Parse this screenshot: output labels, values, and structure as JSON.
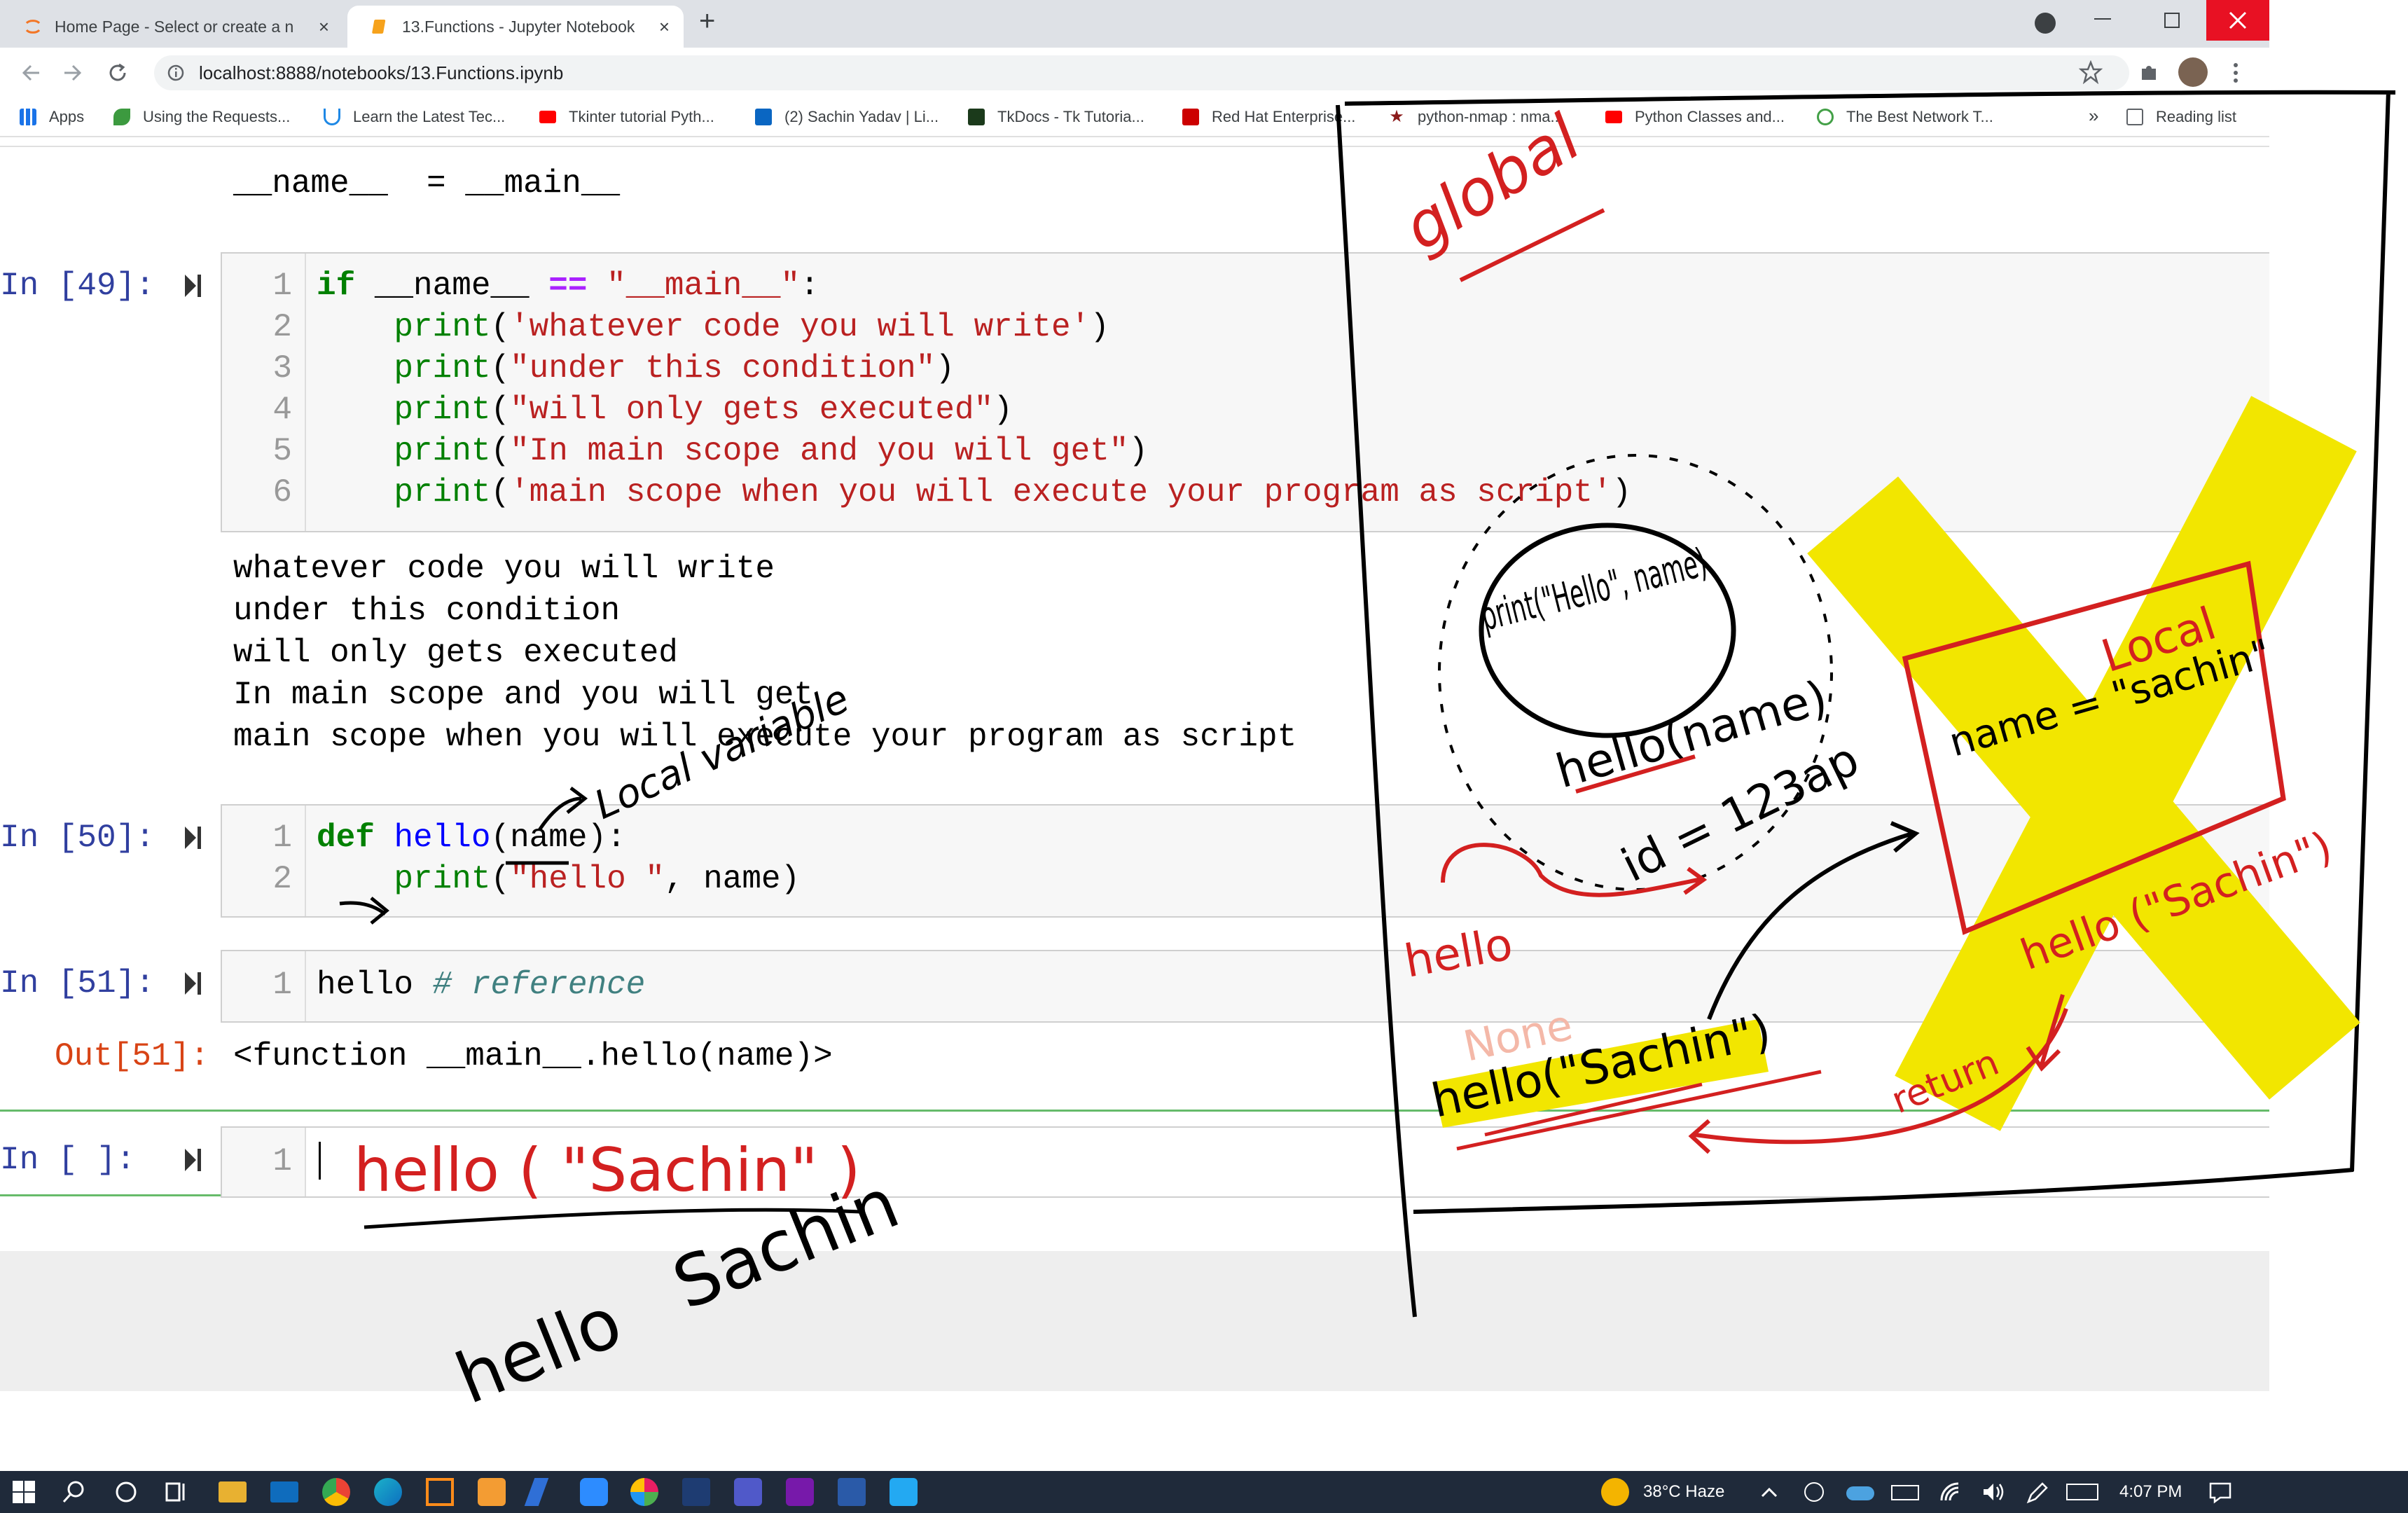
{
  "browser": {
    "tabs": [
      {
        "title": "Home Page - Select or create a n",
        "active": false
      },
      {
        "title": "13.Functions - Jupyter Notebook",
        "active": true
      }
    ],
    "new_tab": "+",
    "close_glyph": "×",
    "url": "localhost:8888/notebooks/13.Functions.ipynb",
    "bookmarks": [
      {
        "label": "Apps",
        "icon": "apps-grid-icon",
        "color": "#1a73e8"
      },
      {
        "label": "Using the Requests...",
        "icon": "leaf-icon",
        "color": "#3c9a3f"
      },
      {
        "label": "Learn the Latest Tec...",
        "icon": "udemy-icon",
        "color": "#1e88e5"
      },
      {
        "label": "Tkinter tutorial Pyth...",
        "icon": "youtube-icon",
        "color": "#ff0000"
      },
      {
        "label": "(2) Sachin Yadav | Li...",
        "icon": "linkedin-icon",
        "color": "#0a66c2"
      },
      {
        "label": "TkDocs - Tk Tutoria...",
        "icon": "tk-icon",
        "color": "#1b5e20"
      },
      {
        "label": "Red Hat Enterprise...",
        "icon": "redhat-icon",
        "color": "#cc0000"
      },
      {
        "label": "python-nmap : nma...",
        "icon": "star-icon",
        "color": "#8b1a1a"
      },
      {
        "label": "Python Classes and...",
        "icon": "youtube-icon",
        "color": "#ff0000"
      },
      {
        "label": "The Best Network T...",
        "icon": "network-icon",
        "color": "#43a047"
      }
    ],
    "more_bookmarks": "»",
    "reading_list": "Reading list"
  },
  "notebook": {
    "top_output": "__name__  = __main__",
    "cells": [
      {
        "prompt": "In [49]:",
        "lines": [
          "if __name__ == \"__main__\":",
          "    print('whatever code you will write')",
          "    print(\"under this condition\")",
          "    print(\"will only gets executed\")",
          "    print(\"In main scope and you will get\")",
          "    print('main scope when you will execute your program as script')"
        ],
        "output": [
          "whatever code you will write",
          "under this condition",
          "will only gets executed",
          "In main scope and you will get",
          "main scope when you will execute your program as script"
        ]
      },
      {
        "prompt": "In [50]:",
        "lines": [
          "def hello(name):",
          "    print(\"hello \", name)"
        ]
      },
      {
        "prompt": "In [51]:",
        "lines": [
          "hello # reference"
        ],
        "out_prompt": "Out[51]:",
        "output": [
          "<function __main__.hello(name)>"
        ]
      },
      {
        "prompt": "In [ ]:",
        "lines": [
          ""
        ]
      }
    ],
    "line_numbers": [
      "1",
      "2",
      "3",
      "4",
      "5",
      "6"
    ]
  },
  "annotations": {
    "global": "global",
    "local_var": "Local variable",
    "print_hello": "print(\"Hello\", name)",
    "hello_name": "hello(name)",
    "id_eq": "id = 123ap",
    "hello_side": "hello",
    "none": "None",
    "call_hello": "hello(\"Sachin\")",
    "local": "Local",
    "name_assign": "name = \"sachin\"",
    "hello_sachin_right": "hello (\"Sachin\")",
    "return": "return",
    "cell_hello": "hello ( \"Sachin\" )",
    "hello_word": "hello",
    "sachin_word": "Sachin"
  },
  "taskbar": {
    "weather": "38°C Haze",
    "time": "4:07 PM"
  }
}
